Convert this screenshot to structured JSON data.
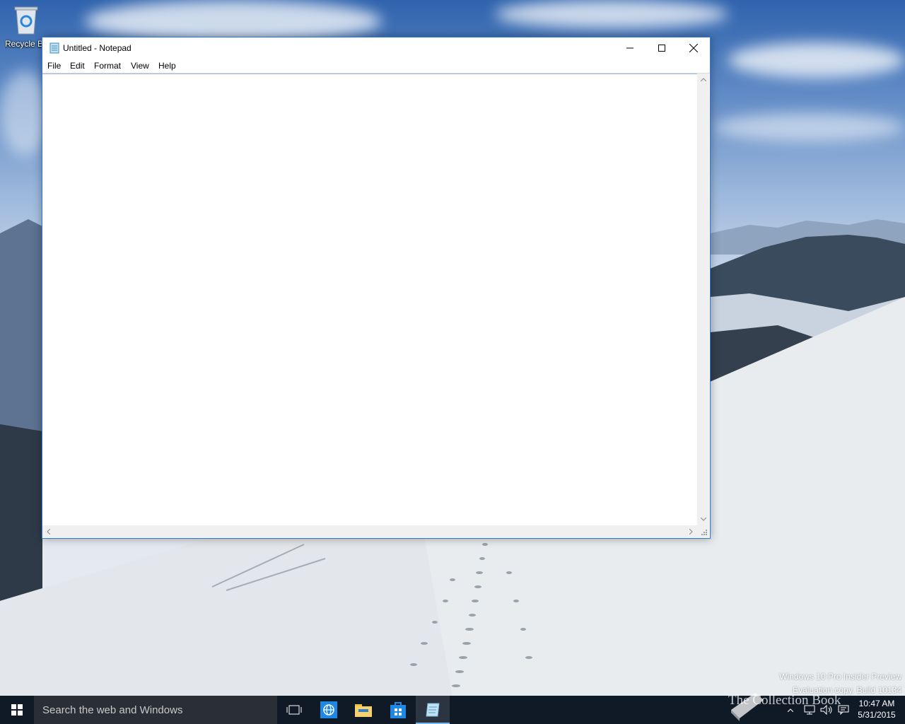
{
  "desktop": {
    "recycle_bin_label": "Recycle Bin"
  },
  "window": {
    "title": "Untitled - Notepad",
    "editor_text": "",
    "menu": [
      "File",
      "Edit",
      "Format",
      "View",
      "Help"
    ]
  },
  "watermark": {
    "line1": "Windows 10 Pro Insider Preview",
    "line2": "Evaluation copy. Build 10134"
  },
  "taskbar": {
    "search_placeholder": "Search the web and Windows",
    "apps": [
      "task-view",
      "internet-explorer",
      "file-explorer",
      "store",
      "notepad"
    ],
    "clock_time": "10:47 AM",
    "clock_date": "5/31/2015"
  },
  "overlay_brand": "The Collection Book",
  "colors": {
    "taskbar": "#101a26",
    "window_border": "#2b79d8",
    "active_indicator": "#76b9ed"
  }
}
